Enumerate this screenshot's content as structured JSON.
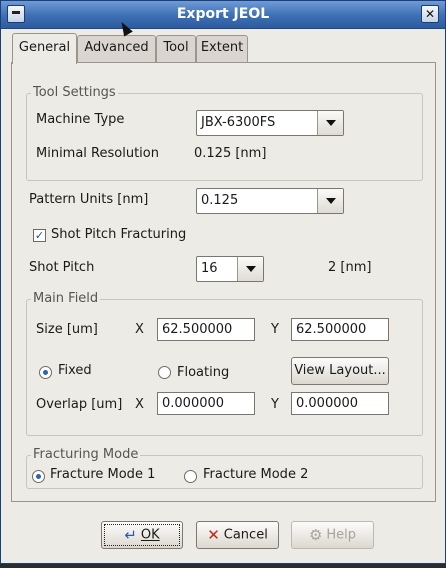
{
  "window": {
    "title": "Export JEOL",
    "close_glyph": "✕"
  },
  "tabs": [
    "General",
    "Advanced",
    "Tool",
    "Extent"
  ],
  "tool_settings": {
    "title": "Tool Settings",
    "machine_type_label": "Machine Type",
    "machine_type_value": "JBX-6300FS",
    "min_res_label": "Minimal Resolution",
    "min_res_value": "0.125 [nm]"
  },
  "pattern_units": {
    "label": "Pattern Units [nm]",
    "value": "0.125"
  },
  "shot_pitch_fracturing": {
    "label": "Shot Pitch Fracturing",
    "checked": true
  },
  "shot_pitch": {
    "label": "Shot Pitch",
    "value": "16",
    "result": "2 [nm]"
  },
  "main_field": {
    "title": "Main Field",
    "size_label": "Size [um]",
    "x_label": "X",
    "y_label": "Y",
    "size_x": "62.500000",
    "size_y": "62.500000",
    "fixed_label": "Fixed",
    "floating_label": "Floating",
    "view_layout": "View Layout...",
    "overlap_label": "Overlap [um]",
    "overlap_x": "0.000000",
    "overlap_y": "0.000000"
  },
  "fracturing_mode": {
    "title": "Fracturing Mode",
    "mode1": "Fracture Mode 1",
    "mode2": "Fracture Mode 2",
    "selected": "mode1"
  },
  "buttons": {
    "ok": "OK",
    "cancel": "Cancel",
    "help": "Help"
  }
}
